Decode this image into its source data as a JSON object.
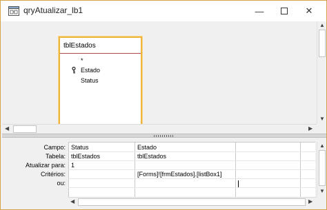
{
  "window": {
    "title": "qryAtualizar_lb1",
    "minimize_glyph": "—",
    "close_glyph": "✕"
  },
  "field_list": {
    "table_name": "tblEstados",
    "fields": [
      "*",
      "Estado",
      "Status"
    ]
  },
  "design_grid": {
    "row_labels": [
      "Campo:",
      "Tabela:",
      "Atualizar para:",
      "Critérios:",
      "ou:"
    ],
    "columns": [
      {
        "campo": "Status",
        "tabela": "tblEstados",
        "atualizar_para": "1",
        "criterios": "",
        "ou": ""
      },
      {
        "campo": "Estado",
        "tabela": "tblEstados",
        "atualizar_para": "",
        "criterios": "[Forms]![frmEstados].[listBox1]",
        "ou": ""
      },
      {
        "campo": "",
        "tabela": "",
        "atualizar_para": "",
        "criterios": "",
        "ou": ""
      }
    ]
  },
  "scroll_glyphs": {
    "up": "▲",
    "down": "▼",
    "left": "◀",
    "right": "▶"
  }
}
